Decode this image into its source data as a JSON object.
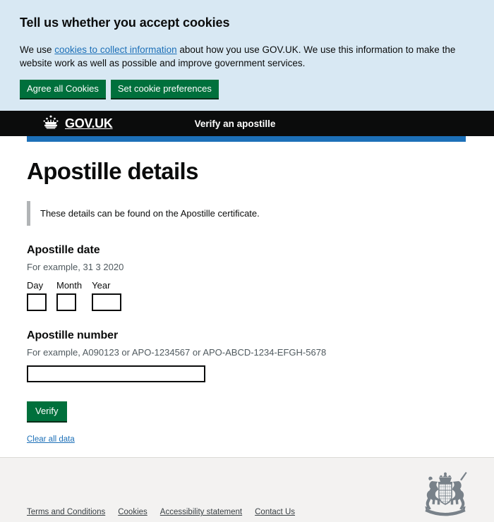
{
  "cookie_banner": {
    "heading": "Tell us whether you accept cookies",
    "body_before_link": "We use ",
    "link_text": "cookies to collect information",
    "body_after_link": " about how you use GOV.UK. We use this information to make the website work as well as possible and improve government services.",
    "agree_button": "Agree all Cookies",
    "preferences_button": "Set cookie preferences",
    "background_color": "#d8e8f3",
    "button_color": "#00703c",
    "link_color": "#1d70b8"
  },
  "header": {
    "logo_text": "GOV.UK",
    "crown_icon": "crown-icon",
    "service_name": "Verify an apostille",
    "background_color": "#0b0c0c",
    "phase_bar_color": "#1d70b8"
  },
  "main": {
    "page_title": "Apostille details",
    "inset_text": "These details can be found on the Apostille certificate.",
    "date_field": {
      "legend": "Apostille date",
      "hint": "For example, 31 3 2020",
      "day": {
        "label": "Day",
        "value": ""
      },
      "month": {
        "label": "Month",
        "value": ""
      },
      "year": {
        "label": "Year",
        "value": ""
      }
    },
    "number_field": {
      "label": "Apostille number",
      "hint": "For example, A090123 or APO-1234567 or APO-ABCD-1234-EFGH-5678",
      "value": ""
    },
    "submit_label": "Verify",
    "clear_link": "Clear all data"
  },
  "footer": {
    "links": [
      "Terms and Conditions",
      "Cookies",
      "Accessibility statement",
      "Contact Us"
    ],
    "crest_icon": "royal-coat-of-arms-icon",
    "background_color": "#f3f2f1"
  }
}
